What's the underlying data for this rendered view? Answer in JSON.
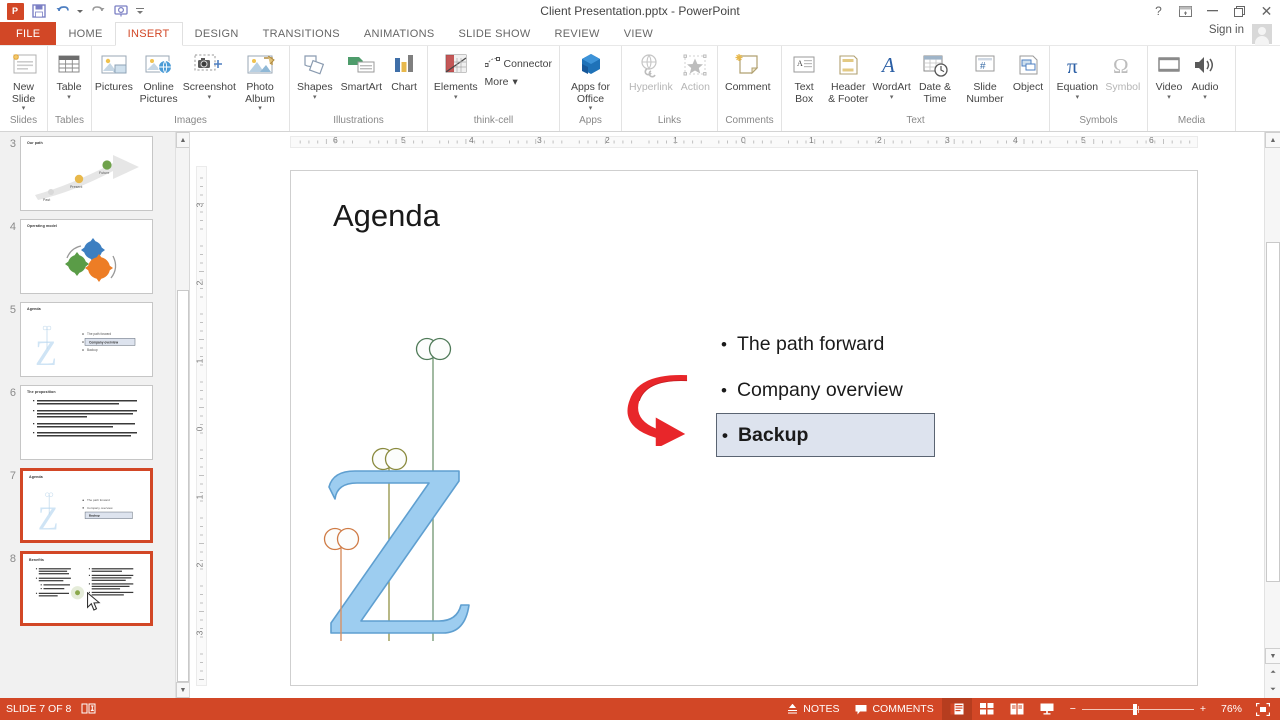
{
  "window": {
    "title": "Client Presentation.pptx - PowerPoint",
    "quick_access": [
      {
        "name": "powerpoint-logo",
        "label": "P"
      },
      {
        "name": "save-icon",
        "label": "ὋE"
      },
      {
        "name": "undo-icon",
        "label": "↶"
      },
      {
        "name": "redo-icon",
        "label": "↻"
      },
      {
        "name": "start-presentation-icon",
        "label": "⎙"
      },
      {
        "name": "customize-qat-icon",
        "label": "≡"
      }
    ],
    "controls": {
      "help": "?",
      "ribbon_display": "⊞",
      "minimize": "─",
      "restore": "❐",
      "close": "✕"
    },
    "sign_in": "Sign in"
  },
  "tabs": [
    {
      "label": "FILE",
      "state": "file"
    },
    {
      "label": "HOME",
      "state": "normal"
    },
    {
      "label": "INSERT",
      "state": "active"
    },
    {
      "label": "DESIGN",
      "state": "normal"
    },
    {
      "label": "TRANSITIONS",
      "state": "normal"
    },
    {
      "label": "ANIMATIONS",
      "state": "normal"
    },
    {
      "label": "SLIDE SHOW",
      "state": "normal"
    },
    {
      "label": "REVIEW",
      "state": "normal"
    },
    {
      "label": "VIEW",
      "state": "normal"
    }
  ],
  "ribbon": {
    "groups": [
      {
        "label": "Slides",
        "items": [
          {
            "label": "New Slide",
            "icon": "new-slide-icon",
            "dropdown": true,
            "disabled": false
          }
        ]
      },
      {
        "label": "Tables",
        "items": [
          {
            "label": "Table",
            "icon": "table-icon",
            "dropdown": true,
            "disabled": false
          }
        ]
      },
      {
        "label": "Images",
        "items": [
          {
            "label": "Pictures",
            "icon": "pictures-icon",
            "dropdown": false,
            "disabled": false
          },
          {
            "label": "Online Pictures",
            "icon": "online-pictures-icon",
            "dropdown": false,
            "disabled": false
          },
          {
            "label": "Screenshot",
            "icon": "screenshot-icon",
            "dropdown": true,
            "disabled": false
          },
          {
            "label": "Photo Album",
            "icon": "photo-album-icon",
            "dropdown": true,
            "disabled": false
          }
        ]
      },
      {
        "label": "Illustrations",
        "items": [
          {
            "label": "Shapes",
            "icon": "shapes-icon",
            "dropdown": true,
            "disabled": false
          },
          {
            "label": "SmartArt",
            "icon": "smartart-icon",
            "dropdown": false,
            "disabled": false
          },
          {
            "label": "Chart",
            "icon": "chart-icon",
            "dropdown": false,
            "disabled": false
          }
        ]
      },
      {
        "label": "think-cell",
        "items": [
          {
            "label": "Elements",
            "icon": "thinkcell-elements-icon",
            "dropdown": true,
            "disabled": false
          },
          {
            "label": "Connector",
            "icon": "connector-icon",
            "dropdown": false,
            "disabled": false
          },
          {
            "label": "More",
            "icon": "more-icon",
            "dropdown": true,
            "disabled": false
          }
        ]
      },
      {
        "label": "Apps",
        "items": [
          {
            "label": "Apps for Office",
            "icon": "apps-for-office-icon",
            "dropdown": true,
            "disabled": false
          }
        ]
      },
      {
        "label": "Links",
        "items": [
          {
            "label": "Hyperlink",
            "icon": "hyperlink-icon",
            "dropdown": false,
            "disabled": true
          },
          {
            "label": "Action",
            "icon": "action-icon",
            "dropdown": false,
            "disabled": true
          }
        ]
      },
      {
        "label": "Comments",
        "items": [
          {
            "label": "Comment",
            "icon": "comment-icon",
            "dropdown": false,
            "disabled": false
          }
        ]
      },
      {
        "label": "Text",
        "items": [
          {
            "label": "Text Box",
            "icon": "text-box-icon",
            "dropdown": false,
            "disabled": false
          },
          {
            "label": "Header & Footer",
            "icon": "header-footer-icon",
            "dropdown": false,
            "disabled": false
          },
          {
            "label": "WordArt",
            "icon": "wordart-icon",
            "dropdown": true,
            "disabled": false
          },
          {
            "label": "Date & Time",
            "icon": "date-time-icon",
            "dropdown": false,
            "disabled": false
          },
          {
            "label": "Slide Number",
            "icon": "slide-number-icon",
            "dropdown": false,
            "disabled": false
          },
          {
            "label": "Object",
            "icon": "object-icon",
            "dropdown": false,
            "disabled": false
          }
        ]
      },
      {
        "label": "Symbols",
        "items": [
          {
            "label": "Equation",
            "icon": "equation-icon",
            "dropdown": true,
            "disabled": false
          },
          {
            "label": "Symbol",
            "icon": "symbol-icon",
            "dropdown": false,
            "disabled": true
          }
        ]
      },
      {
        "label": "Media",
        "items": [
          {
            "label": "Video",
            "icon": "video-icon",
            "dropdown": true,
            "disabled": false
          },
          {
            "label": "Audio",
            "icon": "audio-icon",
            "dropdown": true,
            "disabled": false
          }
        ]
      }
    ]
  },
  "thumbnails": [
    {
      "number": "3",
      "title": "Our path",
      "selected": false,
      "kind": "arrow-timeline",
      "labels": [
        "Past",
        "Present",
        "Future"
      ]
    },
    {
      "number": "4",
      "title": "Operating model",
      "selected": false,
      "kind": "gears"
    },
    {
      "number": "5",
      "title": "Agenda",
      "selected": false,
      "kind": "agenda",
      "highlight_index": 1
    },
    {
      "number": "6",
      "title": "The proposition",
      "selected": false,
      "kind": "bullets"
    },
    {
      "number": "7",
      "title": "Agenda",
      "selected": true,
      "kind": "agenda",
      "highlight_index": 2
    },
    {
      "number": "8",
      "title": "Benefits",
      "selected": true,
      "kind": "two-column"
    }
  ],
  "rulers": {
    "horizontal": [
      "6",
      "5",
      "4",
      "3",
      "2",
      "1",
      "0",
      "1",
      "2",
      "3",
      "4",
      "5",
      "6"
    ],
    "vertical": [
      "3",
      "2",
      "1",
      "0",
      "1",
      "2",
      "3"
    ]
  },
  "slide": {
    "title": "Agenda",
    "bullets": [
      {
        "text": "The path forward",
        "highlighted": false
      },
      {
        "text": "Company overview",
        "highlighted": false
      },
      {
        "text": "Backup",
        "highlighted": true
      }
    ],
    "artwork": {
      "name": "stylized-z-graphic",
      "letter": "Z",
      "letter_color": "#9dcdf0",
      "stem_colors": [
        "#6f9e6f",
        "#9a9a52",
        "#d99163"
      ]
    },
    "annotation": {
      "name": "red-curved-arrow",
      "color": "#e8262a"
    }
  },
  "statusbar": {
    "slide_indicator": "SLIDE 7 OF 8",
    "language_icon": "language-icon",
    "notes_label": "NOTES",
    "comments_label": "COMMENTS",
    "views": [
      {
        "name": "normal-view",
        "active": true
      },
      {
        "name": "slide-sorter-view",
        "active": false
      },
      {
        "name": "reading-view",
        "active": false
      },
      {
        "name": "slide-show-view",
        "active": false
      }
    ],
    "zoom_out": "−",
    "zoom_in": "+",
    "zoom_level": "76%",
    "fit_to_window": "fit-slide-icon"
  }
}
